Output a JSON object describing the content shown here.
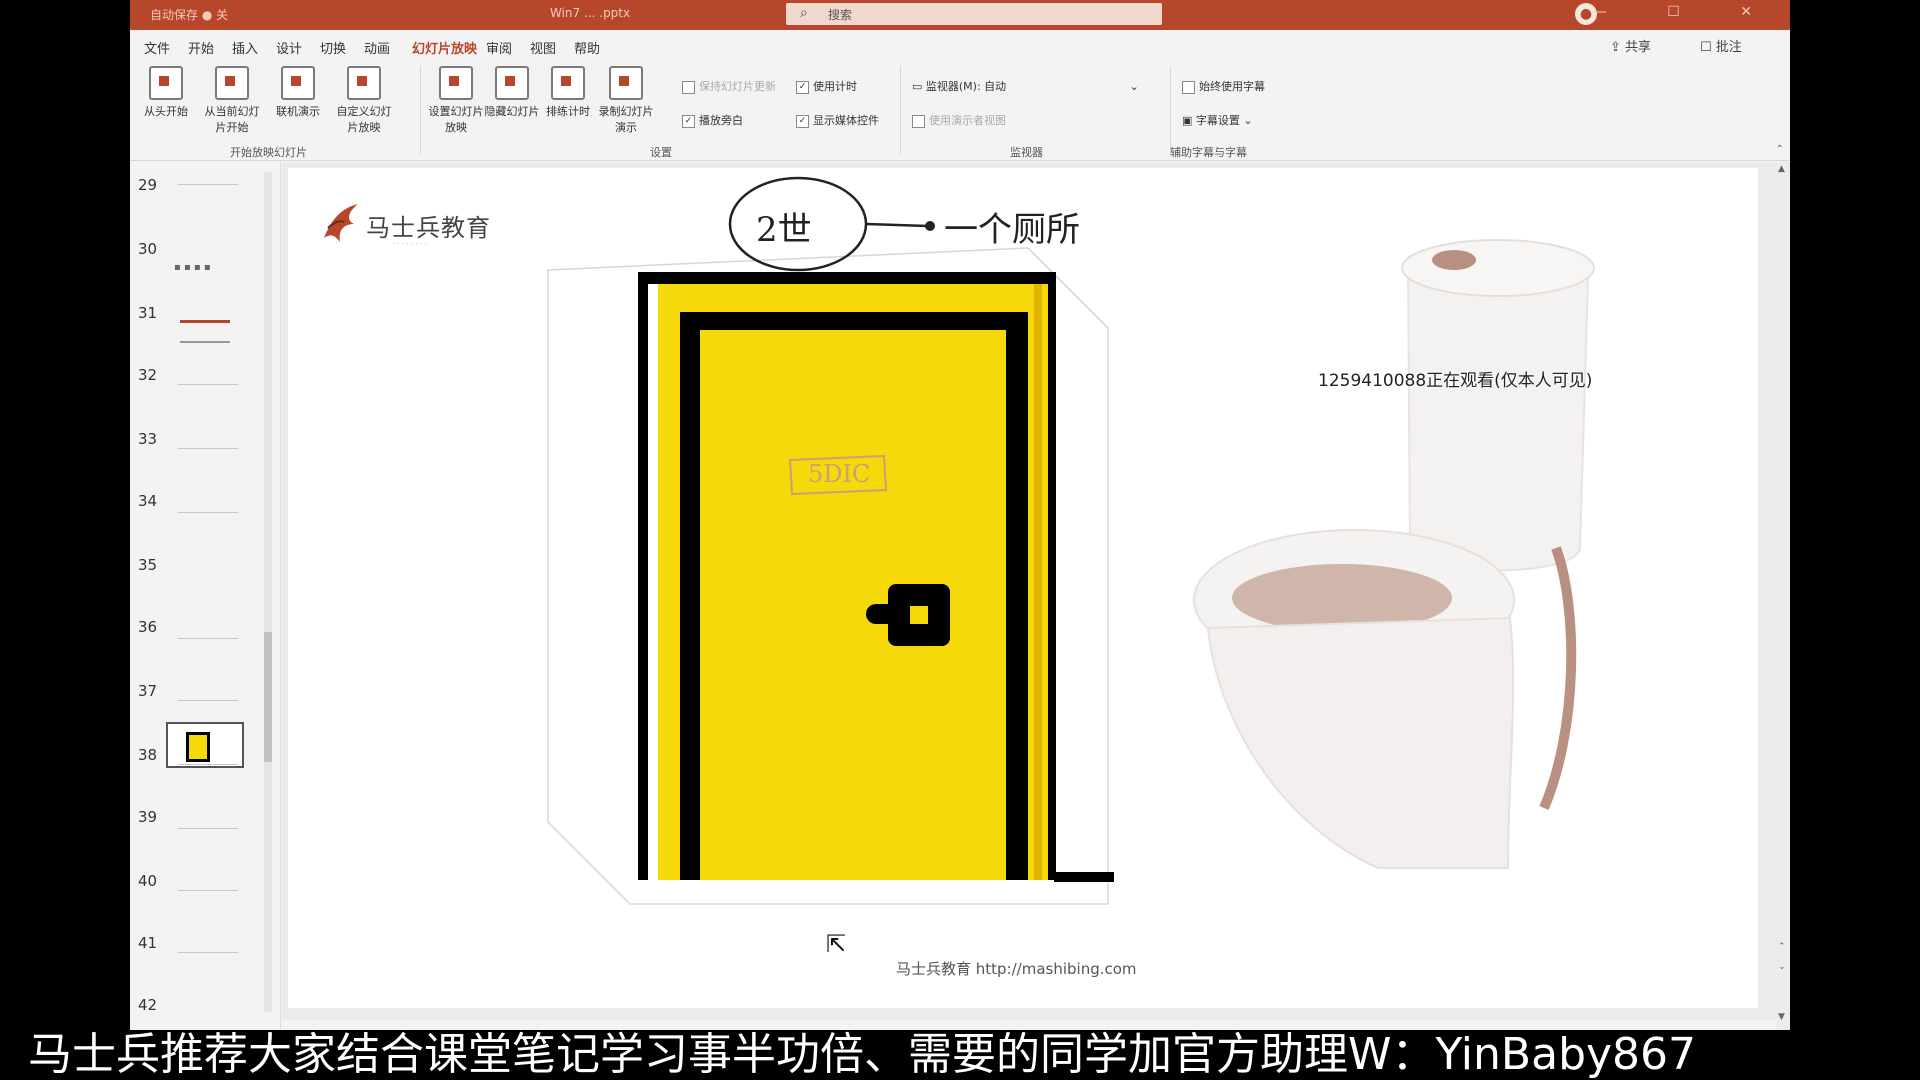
{
  "titlebar": {
    "quick_access": "自动保存 ● 关",
    "doc_name": "Win7 ... .pptx",
    "search_placeholder": "搜索",
    "user": "",
    "window_buttons": "— ☐ ✕"
  },
  "menu": {
    "tabs": [
      "文件",
      "开始",
      "插入",
      "设计",
      "切换",
      "动画",
      "幻灯片放映",
      "审阅",
      "视图",
      "帮助"
    ],
    "active_tab": "幻灯片放映",
    "share": "共享",
    "notes": "批注"
  },
  "ribbon": {
    "group1": {
      "buttons": [
        "从头开始",
        "从当前幻灯片开始",
        "联机演示",
        "自定义幻灯片放映"
      ],
      "label": "开始放映幻灯片"
    },
    "group2": {
      "buttons": [
        "设置幻灯片放映",
        "隐藏幻灯片",
        "排练计时",
        "录制幻灯片演示"
      ],
      "checkbox_play_narr": "播放旁白",
      "checkbox_timing": "使用计时",
      "checkbox_media": "显示媒体控件",
      "checkbox_keep_updated": "保持幻灯片更新",
      "label": "设置"
    },
    "group3": {
      "monitor_label": "监视器(M):",
      "monitor_value": "自动",
      "presenter_view": "使用演示者视图",
      "label": "监视器"
    },
    "group4": {
      "always_subtitles": "始终使用字幕",
      "subtitle_settings": "字幕设置",
      "label": "辅助字幕与字幕"
    }
  },
  "thumbnails": {
    "numbers": [
      "29",
      "30",
      "31",
      "32",
      "33",
      "34",
      "35",
      "36",
      "37",
      "38",
      "39",
      "40",
      "41",
      "42"
    ],
    "active": "35"
  },
  "slide": {
    "logo_text": "马士兵教育",
    "annotation_circled": "2世",
    "annotation_text": "一个厕所",
    "door_sign": "5DIC",
    "watermark": "1259410088正在观看(仅本人可见)",
    "footer_url": "马士兵教育 http://mashibing.com"
  },
  "caption": "马士兵推荐大家结合课堂笔记学习事半功倍、需要的同学加官方助理W：YinBaby867",
  "colors": {
    "accent": "#b7472a",
    "door": "#f5d90a",
    "door_frame": "#000000"
  }
}
